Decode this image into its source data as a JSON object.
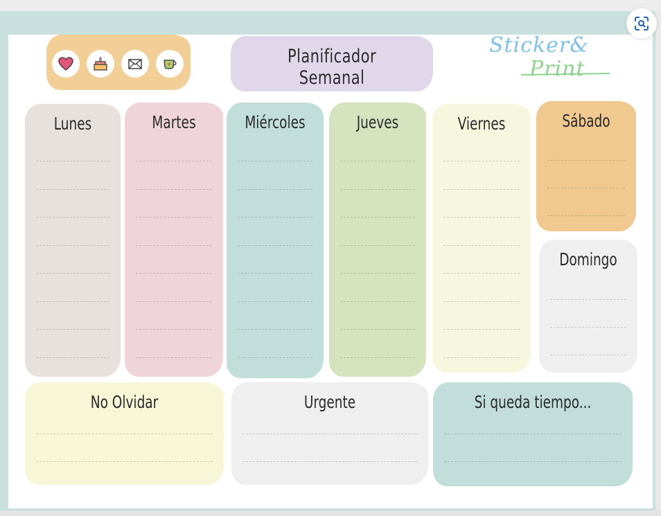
{
  "planner": {
    "title": "Planificador Semanal",
    "brand": {
      "line1": "Sticker&",
      "line2": "Print"
    },
    "header_icons": [
      "heart-icon",
      "cake-icon",
      "envelope-icon",
      "coffee-cup-icon"
    ],
    "days": [
      {
        "label": "Lunes",
        "color": "#e7e1dd"
      },
      {
        "label": "Martes",
        "color": "#efd5da"
      },
      {
        "label": "Miércoles",
        "color": "#c2dedb"
      },
      {
        "label": "Jueves",
        "color": "#d5e4be"
      },
      {
        "label": "Viernes",
        "color": "#f7f7df"
      },
      {
        "label": "Sábado",
        "color": "#efc98f"
      },
      {
        "label": "Domingo",
        "color": "#efefef"
      }
    ],
    "sections": [
      {
        "label": "No Olvidar",
        "color": "#f7f7d8"
      },
      {
        "label": "Urgente",
        "color": "#efefef"
      },
      {
        "label": "Si queda tiempo...",
        "color": "#c2dedb"
      }
    ]
  },
  "ui": {
    "zoom_button_icon": "visual-search-icon"
  },
  "colors": {
    "frame": "#c9e0df",
    "title_bg": "#e1d7ea",
    "icons_bg": "#f2cf97"
  }
}
